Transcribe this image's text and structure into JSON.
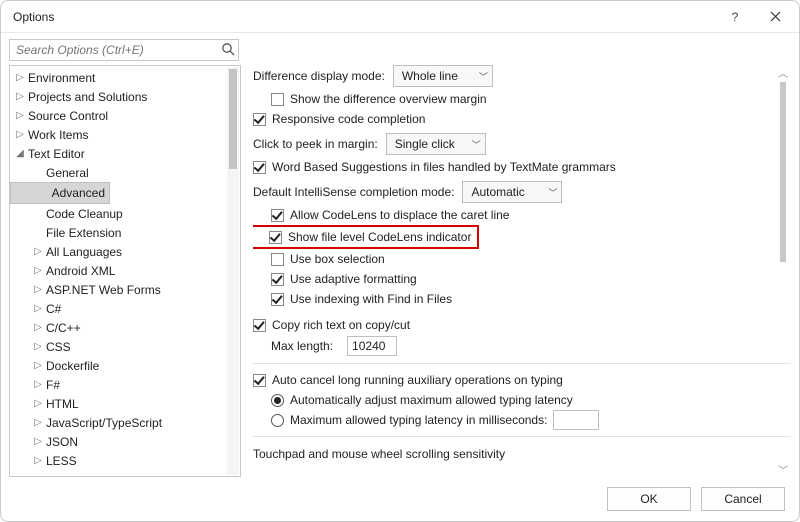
{
  "window": {
    "title": "Options"
  },
  "search": {
    "placeholder": "Search Options (Ctrl+E)"
  },
  "tree": {
    "items": [
      {
        "label": "Environment",
        "level": 1,
        "tw": "▷"
      },
      {
        "label": "Projects and Solutions",
        "level": 1,
        "tw": "▷"
      },
      {
        "label": "Source Control",
        "level": 1,
        "tw": "▷"
      },
      {
        "label": "Work Items",
        "level": 1,
        "tw": "▷"
      },
      {
        "label": "Text Editor",
        "level": 1,
        "tw": "◢"
      },
      {
        "label": "General",
        "level": 2,
        "tw": ""
      },
      {
        "label": "Advanced",
        "level": 2,
        "tw": "",
        "selected": true
      },
      {
        "label": "Code Cleanup",
        "level": 2,
        "tw": ""
      },
      {
        "label": "File Extension",
        "level": 2,
        "tw": ""
      },
      {
        "label": "All Languages",
        "level": 2,
        "tw": "▷"
      },
      {
        "label": "Android XML",
        "level": 2,
        "tw": "▷"
      },
      {
        "label": "ASP.NET Web Forms",
        "level": 2,
        "tw": "▷"
      },
      {
        "label": "C#",
        "level": 2,
        "tw": "▷"
      },
      {
        "label": "C/C++",
        "level": 2,
        "tw": "▷"
      },
      {
        "label": "CSS",
        "level": 2,
        "tw": "▷"
      },
      {
        "label": "Dockerfile",
        "level": 2,
        "tw": "▷"
      },
      {
        "label": "F#",
        "level": 2,
        "tw": "▷"
      },
      {
        "label": "HTML",
        "level": 2,
        "tw": "▷"
      },
      {
        "label": "JavaScript/TypeScript",
        "level": 2,
        "tw": "▷"
      },
      {
        "label": "JSON",
        "level": 2,
        "tw": "▷"
      },
      {
        "label": "LESS",
        "level": 2,
        "tw": "▷"
      }
    ]
  },
  "settings": {
    "diff_mode_label": "Difference display mode:",
    "diff_mode_value": "Whole line",
    "show_diff_overview": "Show the difference overview margin",
    "responsive_completion": "Responsive code completion",
    "click_peek_label": "Click to peek in margin:",
    "click_peek_value": "Single click",
    "word_based": "Word Based Suggestions in files handled by TextMate grammars",
    "intellisense_label": "Default IntelliSense completion mode:",
    "intellisense_value": "Automatic",
    "allow_codelens": "Allow CodeLens to displace the caret line",
    "show_file_codelens": "Show file level CodeLens indicator",
    "use_box_selection": "Use box selection",
    "use_adaptive_formatting": "Use adaptive formatting",
    "use_indexing_find": "Use indexing with Find in Files",
    "copy_rich_text": "Copy rich text on copy/cut",
    "max_length_label": "Max length:",
    "max_length_value": "10240",
    "auto_cancel": "Auto cancel long running auxiliary operations on typing",
    "radio_auto": "Automatically adjust maximum allowed typing latency",
    "radio_manual": "Maximum allowed typing latency in milliseconds:",
    "radio_manual_value": "",
    "touchpad_label": "Touchpad and mouse wheel scrolling sensitivity"
  },
  "footer": {
    "ok": "OK",
    "cancel": "Cancel"
  }
}
